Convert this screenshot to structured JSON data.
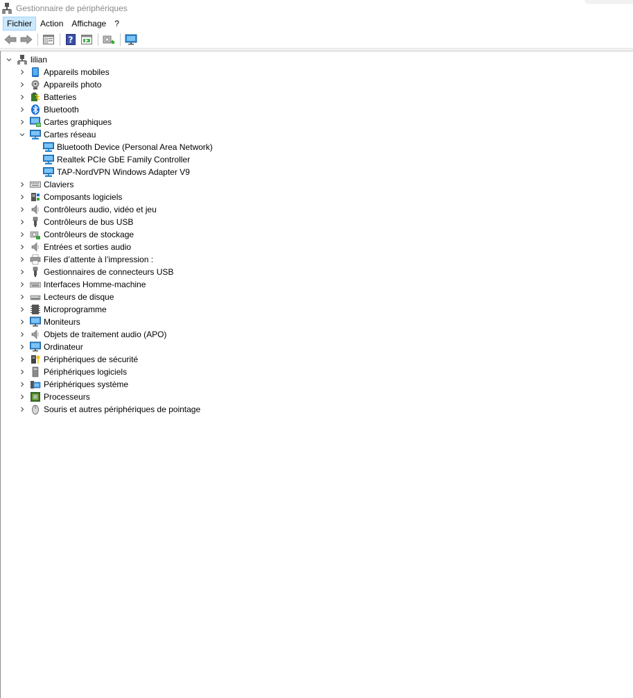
{
  "window": {
    "title": "Gestionnaire de périphériques"
  },
  "menu": [
    {
      "label": "Fichier",
      "active": true
    },
    {
      "label": "Action"
    },
    {
      "label": "Affichage"
    },
    {
      "label": "?"
    }
  ],
  "toolbar": {
    "buttons": [
      "back-arrow-icon",
      "forward-arrow-icon",
      "properties-icon",
      "help-icon",
      "update-driver-icon",
      "scan-hardware-icon",
      "monitor-icon"
    ]
  },
  "tree": {
    "root": {
      "label": "lilian",
      "icon": "computer-icon",
      "expanded": true
    },
    "categories": [
      {
        "label": "Appareils mobiles",
        "icon": "mobile-icon"
      },
      {
        "label": "Appareils photo",
        "icon": "camera-icon"
      },
      {
        "label": "Batteries",
        "icon": "battery-icon"
      },
      {
        "label": "Bluetooth",
        "icon": "bluetooth-icon"
      },
      {
        "label": "Cartes graphiques",
        "icon": "display-adapter-icon"
      },
      {
        "label": "Cartes réseau",
        "icon": "network-adapter-icon",
        "expanded": true,
        "children": [
          {
            "label": "Bluetooth Device (Personal Area Network)",
            "icon": "network-adapter-icon"
          },
          {
            "label": "Realtek PCIe GbE Family Controller",
            "icon": "network-adapter-icon"
          },
          {
            "label": "TAP-NordVPN Windows Adapter V9",
            "icon": "network-adapter-icon"
          }
        ]
      },
      {
        "label": "Claviers",
        "icon": "keyboard-icon"
      },
      {
        "label": "Composants logiciels",
        "icon": "software-component-icon"
      },
      {
        "label": "Contrôleurs audio, vidéo et jeu",
        "icon": "speaker-icon"
      },
      {
        "label": "Contrôleurs de bus USB",
        "icon": "usb-icon"
      },
      {
        "label": "Contrôleurs de stockage",
        "icon": "storage-controller-icon"
      },
      {
        "label": "Entrées et sorties audio",
        "icon": "speaker-icon"
      },
      {
        "label": "Files d’attente à l’impression :",
        "icon": "printer-icon"
      },
      {
        "label": "Gestionnaires de connecteurs USB",
        "icon": "usb-icon"
      },
      {
        "label": "Interfaces Homme-machine",
        "icon": "hid-icon"
      },
      {
        "label": "Lecteurs de disque",
        "icon": "disk-drive-icon"
      },
      {
        "label": "Microprogramme",
        "icon": "firmware-icon"
      },
      {
        "label": "Moniteurs",
        "icon": "monitor-icon"
      },
      {
        "label": "Objets de traitement audio (APO)",
        "icon": "speaker-icon"
      },
      {
        "label": "Ordinateur",
        "icon": "monitor-icon"
      },
      {
        "label": "Périphériques de sécurité",
        "icon": "security-icon"
      },
      {
        "label": "Périphériques logiciels",
        "icon": "software-device-icon"
      },
      {
        "label": "Périphériques système",
        "icon": "system-device-icon"
      },
      {
        "label": "Processeurs",
        "icon": "processor-icon"
      },
      {
        "label": "Souris et autres périphériques de pointage",
        "icon": "mouse-icon"
      }
    ]
  }
}
